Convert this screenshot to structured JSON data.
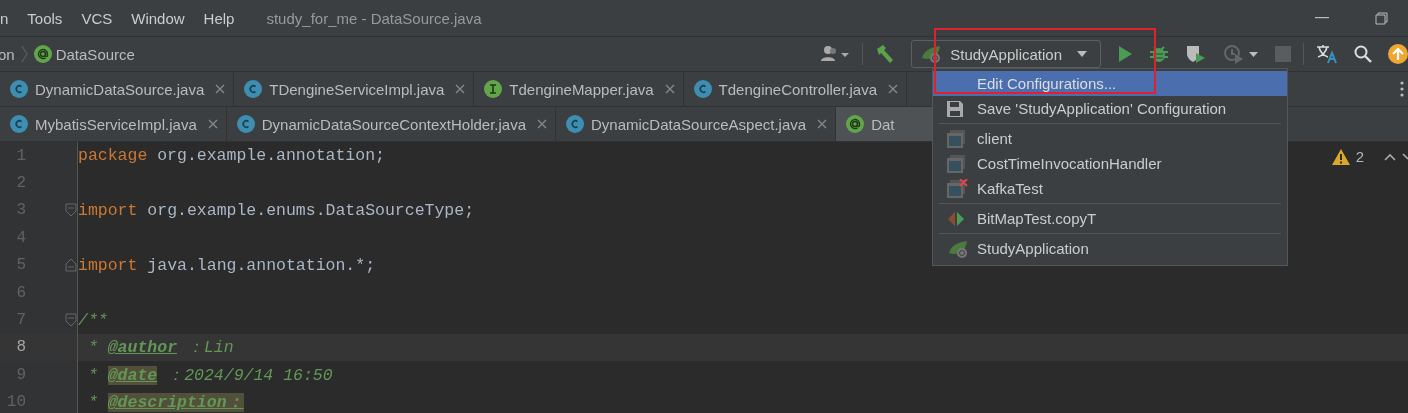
{
  "menu": [
    "n",
    "Tools",
    "VCS",
    "Window",
    "Help"
  ],
  "window": {
    "title": "study_for_me - DataSource.java"
  },
  "breadcrumb": [
    {
      "label": "on",
      "kind": "text"
    },
    {
      "label": "DataSource",
      "kind": "annotation"
    }
  ],
  "run_config": {
    "label": "StudyApplication"
  },
  "tab_rows": [
    [
      {
        "label": "DynamicDataSource.java",
        "kind": "class",
        "selected": false
      },
      {
        "label": "TDengineServiceImpl.java",
        "kind": "class",
        "selected": false
      },
      {
        "label": "TdengineMapper.java",
        "kind": "interface",
        "selected": false
      },
      {
        "label": "TdengineController.java",
        "kind": "class",
        "selected": false
      }
    ],
    [
      {
        "label": "MybatisServiceImpl.java",
        "kind": "class",
        "selected": false
      },
      {
        "label": "DynamicDataSourceContextHolder.java",
        "kind": "class",
        "selected": false
      },
      {
        "label": "DynamicDataSourceAspect.java",
        "kind": "class",
        "selected": false
      },
      {
        "label": "Dat",
        "kind": "annotation",
        "selected": true
      }
    ]
  ],
  "popup": [
    [
      {
        "label": "Edit Configurations...",
        "kind": "none",
        "selected": true
      },
      {
        "label": "Save 'StudyApplication' Configuration",
        "kind": "save",
        "selected": false
      }
    ],
    [
      {
        "label": "client",
        "kind": "app",
        "selected": false
      },
      {
        "label": "CostTimeInvocationHandler",
        "kind": "app",
        "selected": false
      },
      {
        "label": "KafkaTest",
        "kind": "app-error",
        "selected": false
      }
    ],
    [
      {
        "label": "BitMapTest.copyT",
        "kind": "test",
        "selected": false
      }
    ],
    [
      {
        "label": "StudyApplication",
        "kind": "spring",
        "selected": false
      }
    ]
  ],
  "warnings": "2",
  "code": [
    {
      "number": "1",
      "current": false,
      "kind": "plain",
      "tokens": [
        {
          "kind": "keyword",
          "text": "package"
        },
        {
          "kind": "plain",
          "text": " org.example.annotation;"
        }
      ]
    },
    {
      "number": "2",
      "current": false,
      "kind": "plain"
    },
    {
      "number": "3",
      "current": false,
      "kind": "fold-start",
      "tokens": [
        {
          "kind": "keyword",
          "text": "import"
        },
        {
          "kind": "plain",
          "text": " org.example.enums.DataSourceType;"
        }
      ]
    },
    {
      "number": "4",
      "current": false,
      "kind": "plain"
    },
    {
      "number": "5",
      "current": false,
      "kind": "fold-end",
      "tokens": [
        {
          "kind": "keyword",
          "text": "import"
        },
        {
          "kind": "plain",
          "text": " java.lang.annotation.*;"
        }
      ]
    },
    {
      "number": "6",
      "current": false,
      "kind": "plain"
    },
    {
      "number": "7",
      "current": false,
      "kind": "fold-start",
      "tokens": [
        {
          "kind": "doc",
          "text": "/**"
        }
      ]
    },
    {
      "number": "8",
      "current": true,
      "kind": "plain",
      "tokens": [
        {
          "kind": "doc",
          "text": " * "
        },
        {
          "kind": "tag",
          "text": "@author",
          "highlighted": false
        },
        {
          "kind": "doc",
          "text": " ：Lin"
        }
      ]
    },
    {
      "number": "9",
      "current": false,
      "kind": "plain",
      "tokens": [
        {
          "kind": "doc",
          "text": " * "
        },
        {
          "kind": "tag",
          "text": "@date",
          "highlighted": true
        },
        {
          "kind": "doc",
          "text": " ：2024/9/14 16:50"
        }
      ]
    },
    {
      "number": "10",
      "current": false,
      "kind": "plain",
      "tokens": [
        {
          "kind": "doc",
          "text": " * "
        },
        {
          "kind": "tag",
          "text": "@description：",
          "highlighted": true
        }
      ]
    }
  ]
}
